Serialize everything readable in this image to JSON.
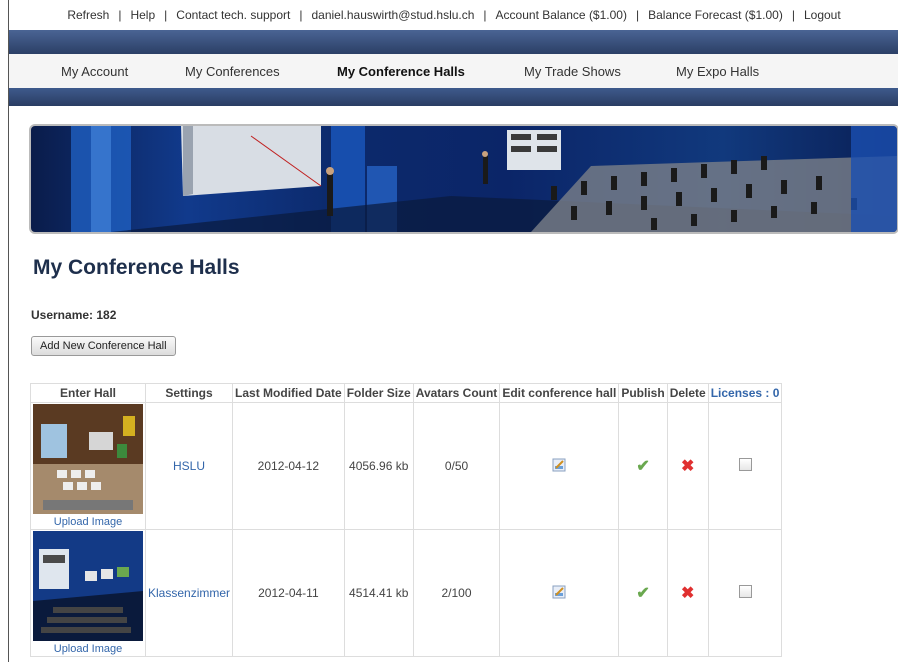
{
  "topbar": {
    "items": [
      "Refresh",
      "Help",
      "Contact tech. support",
      "daniel.hauswirth@stud.hslu.ch",
      "Account Balance ($1.00)",
      "Balance Forecast ($1.00)",
      "Logout"
    ]
  },
  "nav": {
    "tabs": [
      {
        "label": "My Account"
      },
      {
        "label": "My Conferences"
      },
      {
        "label": "My Conference Halls",
        "active": true
      },
      {
        "label": "My Trade Shows"
      },
      {
        "label": "My Expo Halls"
      }
    ]
  },
  "page": {
    "title": "My Conference Halls",
    "username_label": "Username: 182",
    "add_button": "Add New Conference Hall"
  },
  "table": {
    "headers": [
      "Enter Hall",
      "Settings",
      "Last Modified Date",
      "Folder Size",
      "Avatars Count",
      "Edit conference hall",
      "Publish",
      "Delete",
      "Licenses : 0"
    ],
    "rows": [
      {
        "upload": "Upload Image",
        "settings": "HSLU",
        "date": "2012-04-12",
        "size": "4056.96 kb",
        "avatars": "0/50"
      },
      {
        "upload": "Upload Image",
        "settings": "Klassenzimmer",
        "date": "2012-04-11",
        "size": "4514.41 kb",
        "avatars": "2/100"
      }
    ]
  },
  "icons": {
    "edit": "edit-icon",
    "publish": "check-icon",
    "delete": "cross-icon"
  },
  "colors": {
    "header_band": "#2b3f66",
    "title": "#1e2f4c",
    "link": "#3366aa",
    "publish": "#6aa84f",
    "delete": "#e03030"
  }
}
